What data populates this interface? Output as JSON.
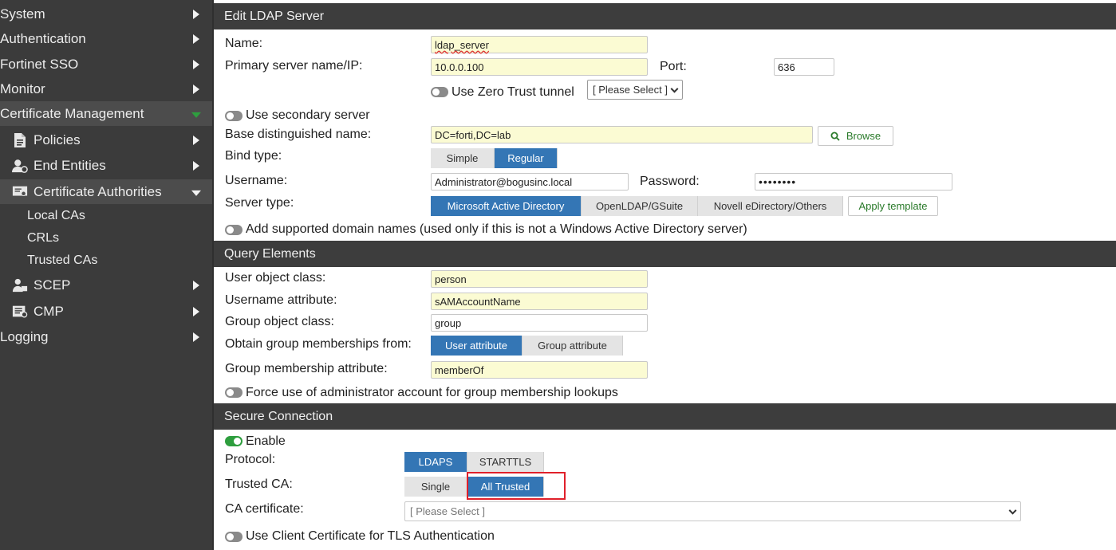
{
  "sidebar": {
    "items": [
      {
        "label": "System"
      },
      {
        "label": "Authentication"
      },
      {
        "label": "Fortinet SSO"
      },
      {
        "label": "Monitor"
      },
      {
        "label": "Certificate Management"
      },
      {
        "label": "Policies"
      },
      {
        "label": "End Entities"
      },
      {
        "label": "Certificate Authorities"
      },
      {
        "label": "Local CAs"
      },
      {
        "label": "CRLs"
      },
      {
        "label": "Trusted CAs"
      },
      {
        "label": "SCEP"
      },
      {
        "label": "CMP"
      },
      {
        "label": "Logging"
      }
    ]
  },
  "edit": {
    "title": "Edit LDAP Server",
    "name_label": "Name:",
    "name_value": "ldap_server",
    "primary_label": "Primary server name/IP:",
    "primary_value": "10.0.0.100",
    "port_label": "Port:",
    "port_value": "636",
    "zero_trust_label": "Use Zero Trust tunnel",
    "zero_trust_select": "[ Please Select ]",
    "secondary_label": "Use secondary server",
    "base_dn_label": "Base distinguished name:",
    "base_dn_value": "DC=forti,DC=lab",
    "browse_label": "Browse",
    "bind_type_label": "Bind type:",
    "bind_options": [
      "Simple",
      "Regular"
    ],
    "username_label": "Username:",
    "username_value": "Administrator@bogusinc.local",
    "password_label": "Password:",
    "password_value": "••••••••",
    "server_type_label": "Server type:",
    "server_type_options": [
      "Microsoft Active Directory",
      "OpenLDAP/GSuite",
      "Novell eDirectory/Others"
    ],
    "apply_template_label": "Apply template",
    "domain_names_label": "Add supported domain names (used only if this is not a Windows Active Directory server)"
  },
  "query": {
    "title": "Query Elements",
    "user_class_label": "User object class:",
    "user_class_value": "person",
    "username_attr_label": "Username attribute:",
    "username_attr_value": "sAMAccountName",
    "group_class_label": "Group object class:",
    "group_class_value": "group",
    "obtain_label": "Obtain group memberships from:",
    "obtain_options": [
      "User attribute",
      "Group attribute"
    ],
    "membership_attr_label": "Group membership attribute:",
    "membership_attr_value": "memberOf",
    "force_admin_label": "Force use of administrator account for group membership lookups"
  },
  "secure": {
    "title": "Secure Connection",
    "enable_label": "Enable",
    "protocol_label": "Protocol:",
    "protocol_options": [
      "LDAPS",
      "STARTTLS"
    ],
    "trusted_ca_label": "Trusted CA:",
    "trusted_ca_options": [
      "Single",
      "All Trusted"
    ],
    "ca_cert_label": "CA certificate:",
    "ca_cert_value": "[ Please Select ]",
    "client_cert_label": "Use Client Certificate for TLS Authentication"
  },
  "colors": {
    "accent": "#3476b5",
    "highlight": "#e0202a",
    "toggle_on": "#2e9e3e"
  }
}
